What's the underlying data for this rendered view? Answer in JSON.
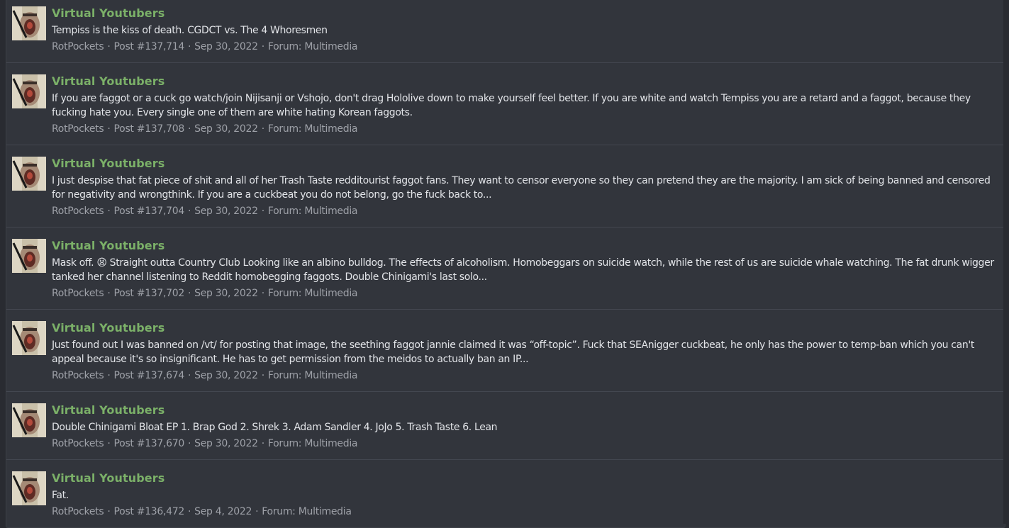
{
  "results": [
    {
      "thread_title": "Virtual Youtubers",
      "snippet": "Tempiss is the kiss of death. CGDCT vs. The 4 Whoresmen",
      "author": "RotPockets",
      "post_number": "Post #137,714",
      "date": "Sep 30, 2022",
      "forum_label": "Forum:",
      "forum_name": "Multimedia"
    },
    {
      "thread_title": "Virtual Youtubers",
      "snippet": "If you are faggot or a cuck go watch/join Nijisanji or Vshojo, don't drag Hololive down to make yourself feel better. If you are white and watch Tempiss you are a retard and a faggot, because they fucking hate you. Every single one of them are white hating Korean faggots.",
      "author": "RotPockets",
      "post_number": "Post #137,708",
      "date": "Sep 30, 2022",
      "forum_label": "Forum:",
      "forum_name": "Multimedia"
    },
    {
      "thread_title": "Virtual Youtubers",
      "snippet": "I just despise that fat piece of shit and all of her Trash Taste redditourist faggot fans. They want to censor everyone so they can pretend they are the majority. I am sick of being banned and censored for negativity and wrongthink. If you are a cuckbeat you do not belong, go the fuck back to...",
      "author": "RotPockets",
      "post_number": "Post #137,704",
      "date": "Sep 30, 2022",
      "forum_label": "Forum:",
      "forum_name": "Multimedia"
    },
    {
      "thread_title": "Virtual Youtubers",
      "snippet": "Mask off. 😫 Straight outta Country Club Looking like an albino bulldog. The effects of alcoholism. Homobeggars on suicide watch, while the rest of us are suicide whale watching. The fat drunk wigger tanked her channel listening to Reddit homobegging faggots. Double Chinigami's last solo...",
      "author": "RotPockets",
      "post_number": "Post #137,702",
      "date": "Sep 30, 2022",
      "forum_label": "Forum:",
      "forum_name": "Multimedia"
    },
    {
      "thread_title": "Virtual Youtubers",
      "snippet": "Just found out I was banned on /vt/ for posting that image, the seething faggot jannie claimed it was “off-topic”. Fuck that SEAnigger cuckbeat, he only has the power to temp-ban which you can't appeal because it's so insignificant. He has to get permission from the meidos to actually ban an IP...",
      "author": "RotPockets",
      "post_number": "Post #137,674",
      "date": "Sep 30, 2022",
      "forum_label": "Forum:",
      "forum_name": "Multimedia"
    },
    {
      "thread_title": "Virtual Youtubers",
      "snippet": "Double Chinigami Bloat EP 1. Brap God 2. Shrek 3. Adam Sandler 4. JoJo 5. Trash Taste 6. Lean",
      "author": "RotPockets",
      "post_number": "Post #137,670",
      "date": "Sep 30, 2022",
      "forum_label": "Forum:",
      "forum_name": "Multimedia"
    },
    {
      "thread_title": "Virtual Youtubers",
      "snippet": "Fat.",
      "author": "RotPockets",
      "post_number": "Post #136,472",
      "date": "Sep 4, 2022",
      "forum_label": "Forum:",
      "forum_name": "Multimedia"
    }
  ],
  "meta_separator": "·",
  "colors": {
    "background": "#292b31",
    "panel": "#32353c",
    "divider": "#434750",
    "title_link": "#7bb068",
    "body_text": "#e2e4e8",
    "meta_text": "#9ea1a8"
  },
  "icons": {
    "avatar": "user-avatar-icon"
  }
}
